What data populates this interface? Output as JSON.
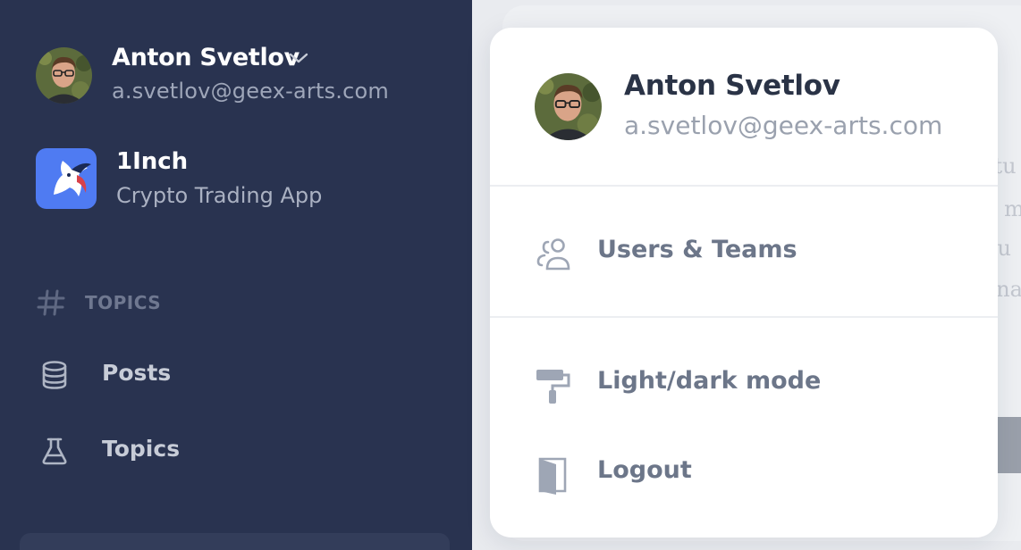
{
  "sidebar": {
    "user": {
      "name": "Anton Svetlov",
      "email": "a.svetlov@geex-arts.com"
    },
    "app": {
      "name": "1Inch",
      "subtitle": "Crypto Trading App"
    },
    "section_label": "TOPICS",
    "nav_items": [
      {
        "label": "Posts",
        "icon": "database-icon"
      },
      {
        "label": "Topics",
        "icon": "flask-icon"
      }
    ]
  },
  "background": {
    "text_fragments": [
      "rtu",
      "u m",
      "nu",
      "ena"
    ]
  },
  "menu": {
    "user": {
      "name": "Anton Svetlov",
      "email": "a.svetlov@geex-arts.com"
    },
    "items": [
      {
        "label": "Users & Teams",
        "icon": "users-icon"
      },
      {
        "label": "Light/dark mode",
        "icon": "paint-roller-icon"
      },
      {
        "label": "Logout",
        "icon": "door-icon"
      }
    ]
  },
  "colors": {
    "sidebar_bg": "#293350",
    "menu_bg": "#ffffff",
    "app_logo_bg": "#4f7bf2",
    "menu_text": "#6c7689"
  }
}
